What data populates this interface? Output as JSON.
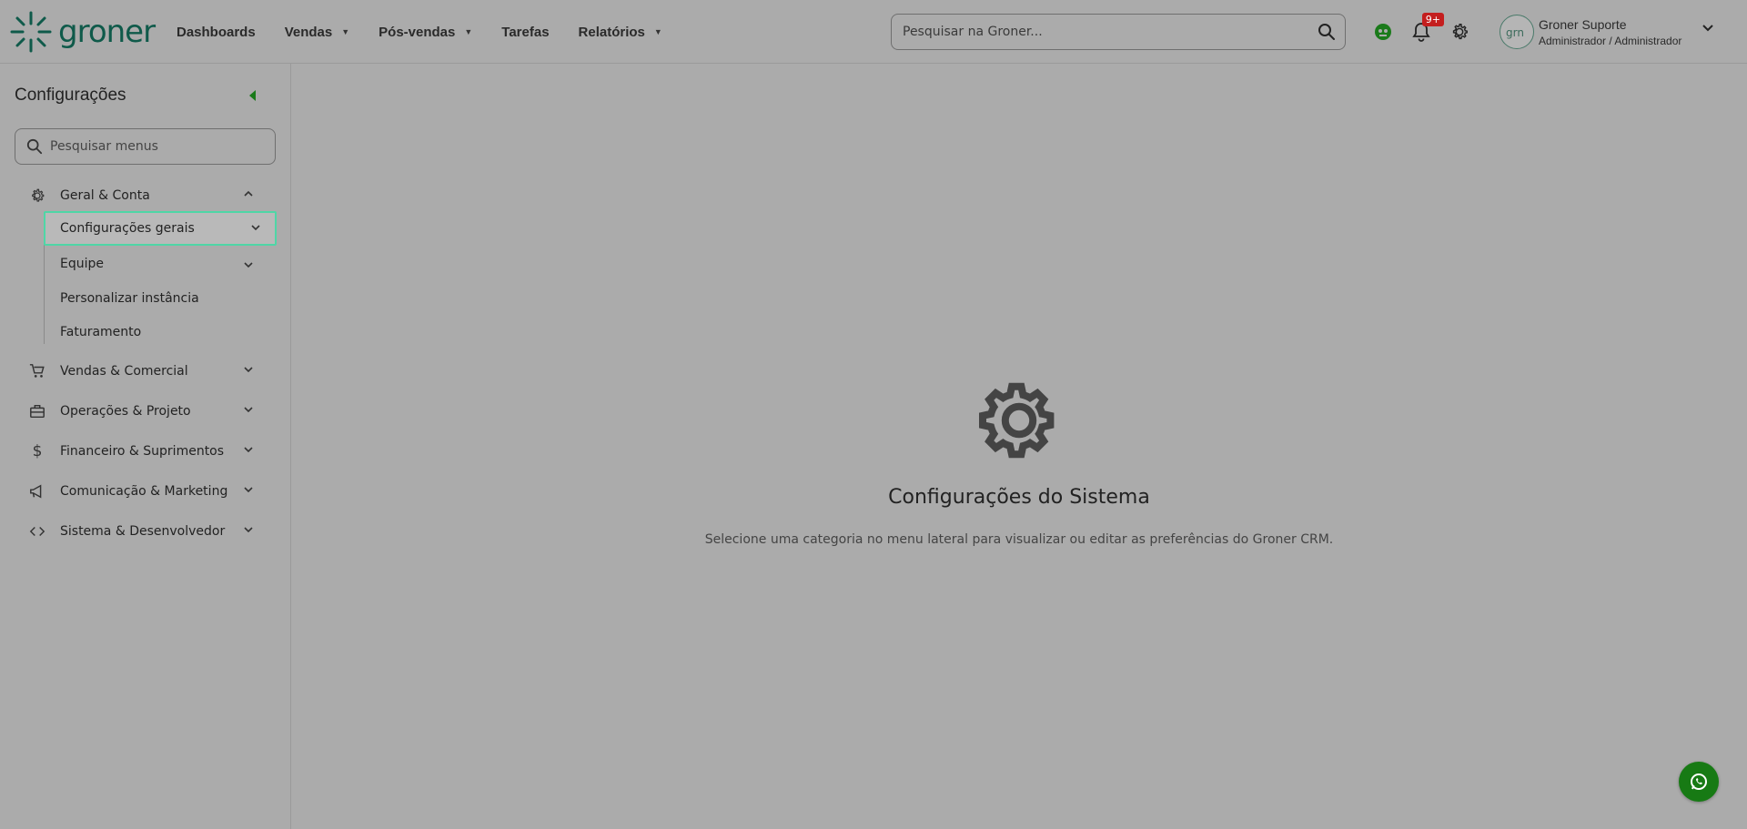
{
  "header": {
    "logo_text": "groner",
    "nav": [
      {
        "label": "Dashboards",
        "has_caret": false
      },
      {
        "label": "Vendas",
        "has_caret": true
      },
      {
        "label": "Pós-vendas",
        "has_caret": true
      },
      {
        "label": "Tarefas",
        "has_caret": false
      },
      {
        "label": "Relatórios",
        "has_caret": true
      }
    ],
    "search_placeholder": "Pesquisar na Groner...",
    "notifications_badge": "9+",
    "user": {
      "name": "Groner Suporte",
      "role": "Administrador / Administrador"
    }
  },
  "sidebar": {
    "title": "Configurações",
    "search_placeholder": "Pesquisar menus",
    "groups": [
      {
        "label": "Geral & Conta",
        "icon": "gear-icon",
        "expanded": true
      },
      {
        "label": "Vendas & Comercial",
        "icon": "cart-icon"
      },
      {
        "label": "Operações & Projeto",
        "icon": "toolbox-icon"
      },
      {
        "label": "Financeiro & Suprimentos",
        "icon": "dollar-icon"
      },
      {
        "label": "Comunicação & Marketing",
        "icon": "megaphone-icon"
      },
      {
        "label": "Sistema & Desenvolvedor",
        "icon": "code-icon"
      }
    ],
    "subitems": [
      {
        "label": "Configurações gerais",
        "active": true
      },
      {
        "label": "Equipe"
      },
      {
        "label": "Personalizar instância"
      },
      {
        "label": "Faturamento"
      }
    ]
  },
  "main": {
    "title": "Configurações do Sistema",
    "subtitle": "Selecione uma categoria no menu lateral para visualizar ou editar as preferências do Groner CRM."
  },
  "colors": {
    "brand": "#0f5a4a",
    "accent": "#4fd6a6",
    "whatsapp": "#177a14",
    "badge": "#c41e1e"
  }
}
